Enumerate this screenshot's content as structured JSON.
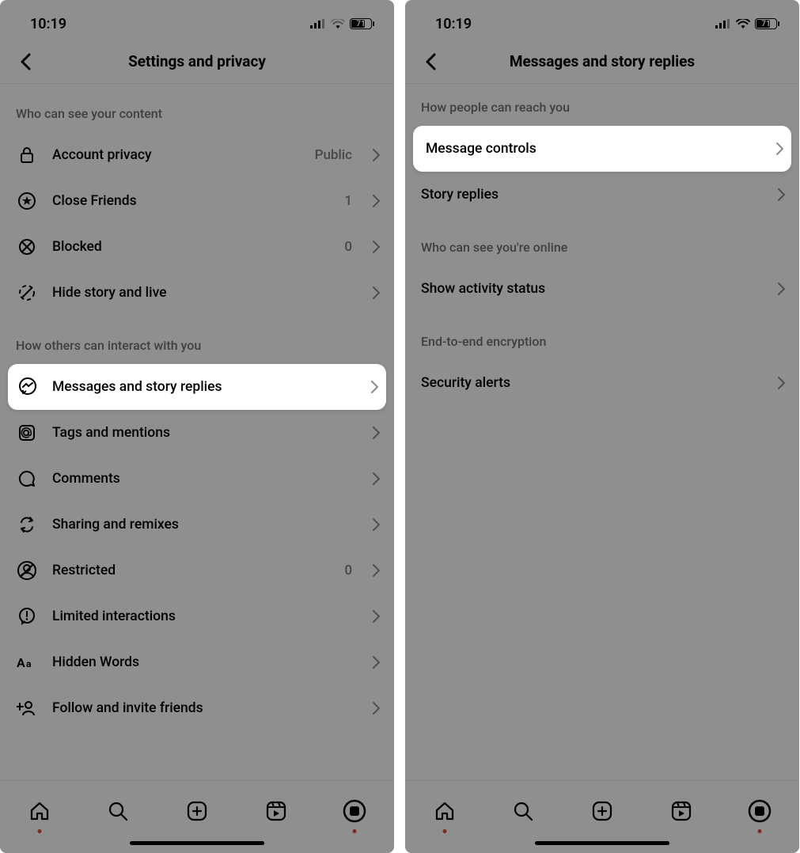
{
  "status": {
    "time": "10:19",
    "battery_percent": "71"
  },
  "screen1": {
    "title": "Settings and privacy",
    "sections": [
      {
        "header": "Who can see your content",
        "items": [
          {
            "icon": "lock-icon",
            "label": "Account privacy",
            "value": "Public"
          },
          {
            "icon": "star-circle-icon",
            "label": "Close Friends",
            "value": "1"
          },
          {
            "icon": "block-icon",
            "label": "Blocked",
            "value": "0"
          },
          {
            "icon": "hide-story-icon",
            "label": "Hide story and live",
            "value": ""
          }
        ]
      },
      {
        "header": "How others can interact with you",
        "items": [
          {
            "icon": "messenger-icon",
            "label": "Messages and story replies",
            "value": "",
            "highlight": true
          },
          {
            "icon": "mention-icon",
            "label": "Tags and mentions",
            "value": ""
          },
          {
            "icon": "comment-icon",
            "label": "Comments",
            "value": ""
          },
          {
            "icon": "remix-icon",
            "label": "Sharing and remixes",
            "value": ""
          },
          {
            "icon": "restricted-icon",
            "label": "Restricted",
            "value": "0"
          },
          {
            "icon": "limited-icon",
            "label": "Limited interactions",
            "value": ""
          },
          {
            "icon": "aa-icon",
            "label": "Hidden Words",
            "value": ""
          },
          {
            "icon": "follow-invite-icon",
            "label": "Follow and invite friends",
            "value": ""
          }
        ]
      }
    ]
  },
  "screen2": {
    "title": "Messages and story replies",
    "sections": [
      {
        "header": "How people can reach you",
        "items": [
          {
            "label": "Message controls",
            "highlight": true
          },
          {
            "label": "Story replies"
          }
        ]
      },
      {
        "header": "Who can see you're online",
        "items": [
          {
            "label": "Show activity status"
          }
        ]
      },
      {
        "header": "End-to-end encryption",
        "items": [
          {
            "label": "Security alerts"
          }
        ]
      }
    ]
  },
  "tabs": [
    "home",
    "search",
    "create",
    "reels",
    "profile"
  ]
}
